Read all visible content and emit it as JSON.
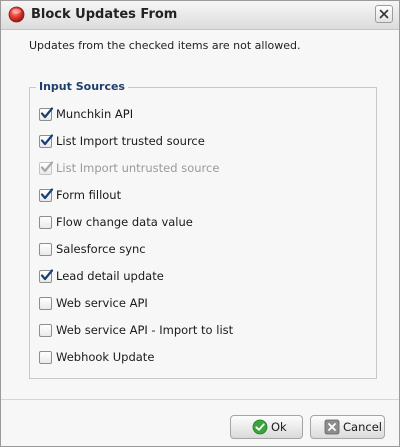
{
  "dialog": {
    "title": "Block Updates From",
    "title_icon": "red-circle-icon",
    "close_icon": "close-icon"
  },
  "intro_text": "Updates from the checked items are not allowed.",
  "group": {
    "legend": "Input Sources",
    "items": [
      {
        "label": "Munchkin API",
        "checked": true,
        "disabled": false
      },
      {
        "label": "List Import trusted source",
        "checked": true,
        "disabled": false
      },
      {
        "label": "List Import untrusted source",
        "checked": true,
        "disabled": true
      },
      {
        "label": "Form fillout",
        "checked": true,
        "disabled": false
      },
      {
        "label": "Flow change data value",
        "checked": false,
        "disabled": false
      },
      {
        "label": "Salesforce sync",
        "checked": false,
        "disabled": false
      },
      {
        "label": "Lead detail update",
        "checked": true,
        "disabled": false
      },
      {
        "label": "Web service API",
        "checked": false,
        "disabled": false
      },
      {
        "label": "Web service API - Import to list",
        "checked": false,
        "disabled": false
      },
      {
        "label": "Webhook Update",
        "checked": false,
        "disabled": false
      }
    ]
  },
  "buttons": {
    "ok_label": "Ok",
    "ok_icon": "green-check-circle-icon",
    "cancel_label": "Cancel",
    "cancel_icon": "gray-x-box-icon"
  },
  "colors": {
    "checkmark": "#1b3f73",
    "checkmark_disabled": "#a8a8a8",
    "legend": "#1f3f6b",
    "ok_icon": "#3aa53a",
    "title_icon": "#d8322b"
  }
}
